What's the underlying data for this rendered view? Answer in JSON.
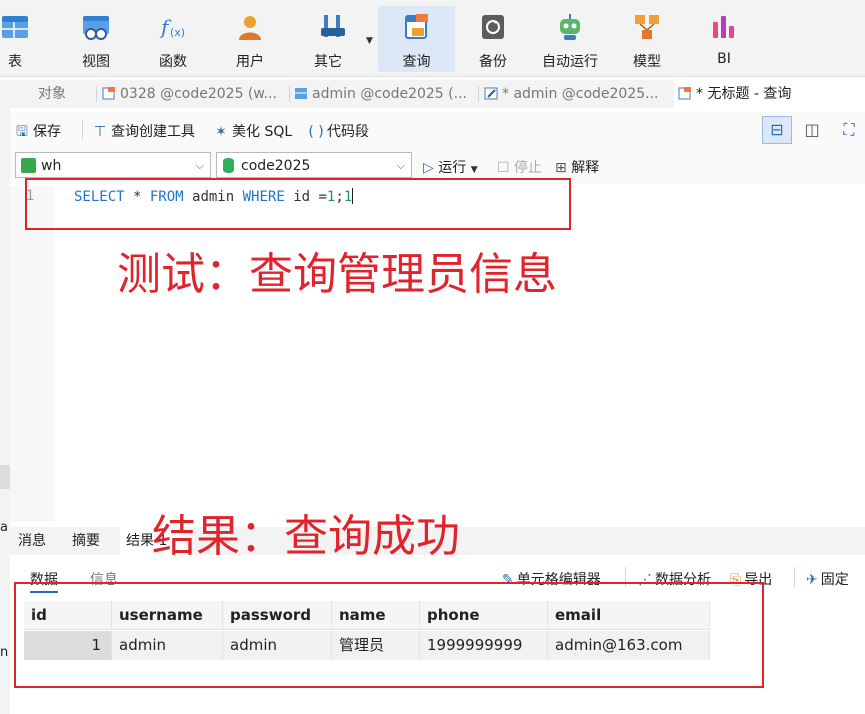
{
  "ribbon": {
    "items": [
      {
        "label": "表",
        "icon": "table-icon"
      },
      {
        "label": "视图",
        "icon": "view-icon"
      },
      {
        "label": "函数",
        "icon": "function-icon"
      },
      {
        "label": "用户",
        "icon": "user-icon"
      },
      {
        "label": "其它",
        "icon": "tools-icon"
      },
      {
        "label": "查询",
        "icon": "query-icon"
      },
      {
        "label": "备份",
        "icon": "backup-icon"
      },
      {
        "label": "自动运行",
        "icon": "robot-icon"
      },
      {
        "label": "模型",
        "icon": "model-icon"
      },
      {
        "label": "BI",
        "icon": "bi-chart-icon"
      }
    ],
    "active": "查询"
  },
  "tabs": [
    {
      "label": "对象"
    },
    {
      "label": "0328 @code2025 (w..."
    },
    {
      "label": "admin @code2025 (..."
    },
    {
      "label": "* admin @code2025..."
    },
    {
      "label": "* 无标题 - 查询"
    }
  ],
  "toolbar": {
    "save": "保存",
    "builder": "查询创建工具",
    "beautify": "美化 SQL",
    "snippet": "代码段"
  },
  "selectors": {
    "connection": "wh",
    "database": "code2025",
    "run": "运行",
    "stop": "停止",
    "explain": "解释"
  },
  "editor": {
    "line_number": "1",
    "tokens": [
      {
        "t": "SELECT",
        "c": "kw"
      },
      {
        "t": " * ",
        "c": "plain"
      },
      {
        "t": "FROM",
        "c": "kw"
      },
      {
        "t": " admin ",
        "c": "plain"
      },
      {
        "t": "WHERE",
        "c": "kw"
      },
      {
        "t": " id =",
        "c": "plain"
      },
      {
        "t": "1",
        "c": "num"
      },
      {
        "t": ";",
        "c": "plain"
      },
      {
        "t": "1",
        "c": "num"
      }
    ]
  },
  "annotations": {
    "top": "测试：查询管理员信息",
    "bottom": "结果：查询成功"
  },
  "result_tabs": [
    "消息",
    "摘要",
    "结果 1"
  ],
  "data_toolbar": {
    "tabs": [
      "数据",
      "信息"
    ],
    "cell_editor": "单元格编辑器",
    "analysis": "数据分析",
    "export": "导出",
    "pin": "固定"
  },
  "grid": {
    "columns": [
      "id",
      "username",
      "password",
      "name",
      "phone",
      "email"
    ],
    "rows": [
      [
        "1",
        "admin",
        "admin",
        "管理员",
        "1999999999",
        "admin@163.com"
      ]
    ]
  },
  "colors": {
    "annotation": "#e0242c",
    "keyword": "#1e74d0",
    "number": "#1c9d5a",
    "active_ribbon": "#dce8f6"
  },
  "edge_fragments": {
    "a": "a",
    "b": "n"
  }
}
